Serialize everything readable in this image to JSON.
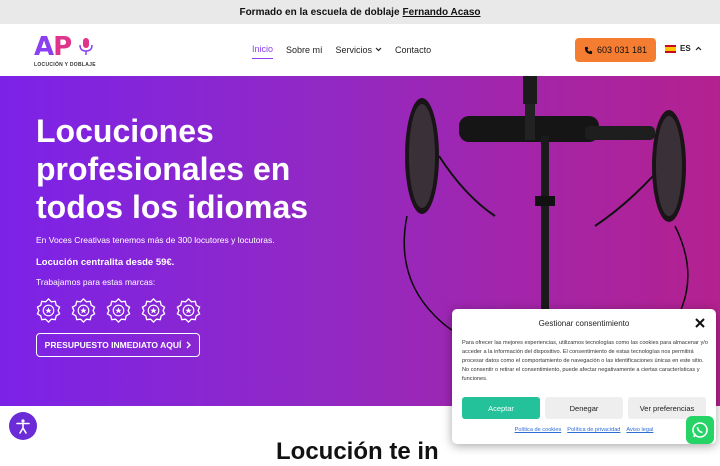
{
  "topbar": {
    "text": "Formado en la escuela de doblaje",
    "link": "Fernando Acaso"
  },
  "logo": {
    "letters_a": "A",
    "letters_p": "P",
    "subtitle": "LOCUCIÓN Y DOBLAJE"
  },
  "nav": {
    "items": [
      "Inicio",
      "Sobre mí",
      "Servicios",
      "Contacto"
    ],
    "active": "Inicio"
  },
  "phone": {
    "label": "603 031 181"
  },
  "language": {
    "code": "ES"
  },
  "hero": {
    "title": "Locuciones profesionales en todos los idiomas",
    "subtitle": "En Voces Creativas tenemos más de 300 locutores y locutoras.",
    "price": "Locución centralita desde 59€.",
    "brands": "Trabajamos para estas marcas:",
    "badge_count": 5,
    "cta": "PRESUPUESTO INMEDIATO AQUÍ"
  },
  "below": {
    "title": "Locución te in"
  },
  "consent": {
    "title": "Gestionar consentimiento",
    "body": "Para ofrecer las mejores experiencias, utilizamos tecnologías como las cookies para almacenar y/o acceder a la información del dispositivo. El consentimiento de estas tecnologías nos permitirá procesar datos como el comportamiento de navegación o las identificaciones únicas en este sitio. No consentir o retirar el consentimiento, puede afectar negativamente a ciertas características y funciones.",
    "accept": "Aceptar",
    "deny": "Denegar",
    "prefs": "Ver preferencias",
    "links": [
      "Política de cookies",
      "Política de privacidad",
      "Aviso legal"
    ]
  },
  "colors": {
    "accent": "#8a3ff0",
    "pink": "#e0338a",
    "phone": "#f57d32",
    "accept": "#23c29a",
    "whatsapp": "#25d366"
  }
}
